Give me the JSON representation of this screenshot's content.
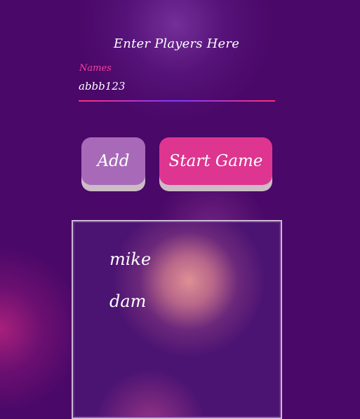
{
  "form": {
    "title": "Enter Players Here",
    "names_label": "Names",
    "names_value": "abbb123"
  },
  "buttons": {
    "add": "Add",
    "start": "Start Game"
  },
  "players": [
    "mike",
    "dam"
  ],
  "colors": {
    "background": "#4a0868",
    "label_accent": "#ff3f9d",
    "add_button": "#a86ab8",
    "start_button": "#dd3590",
    "button_shadow": "#cdbbc6"
  }
}
